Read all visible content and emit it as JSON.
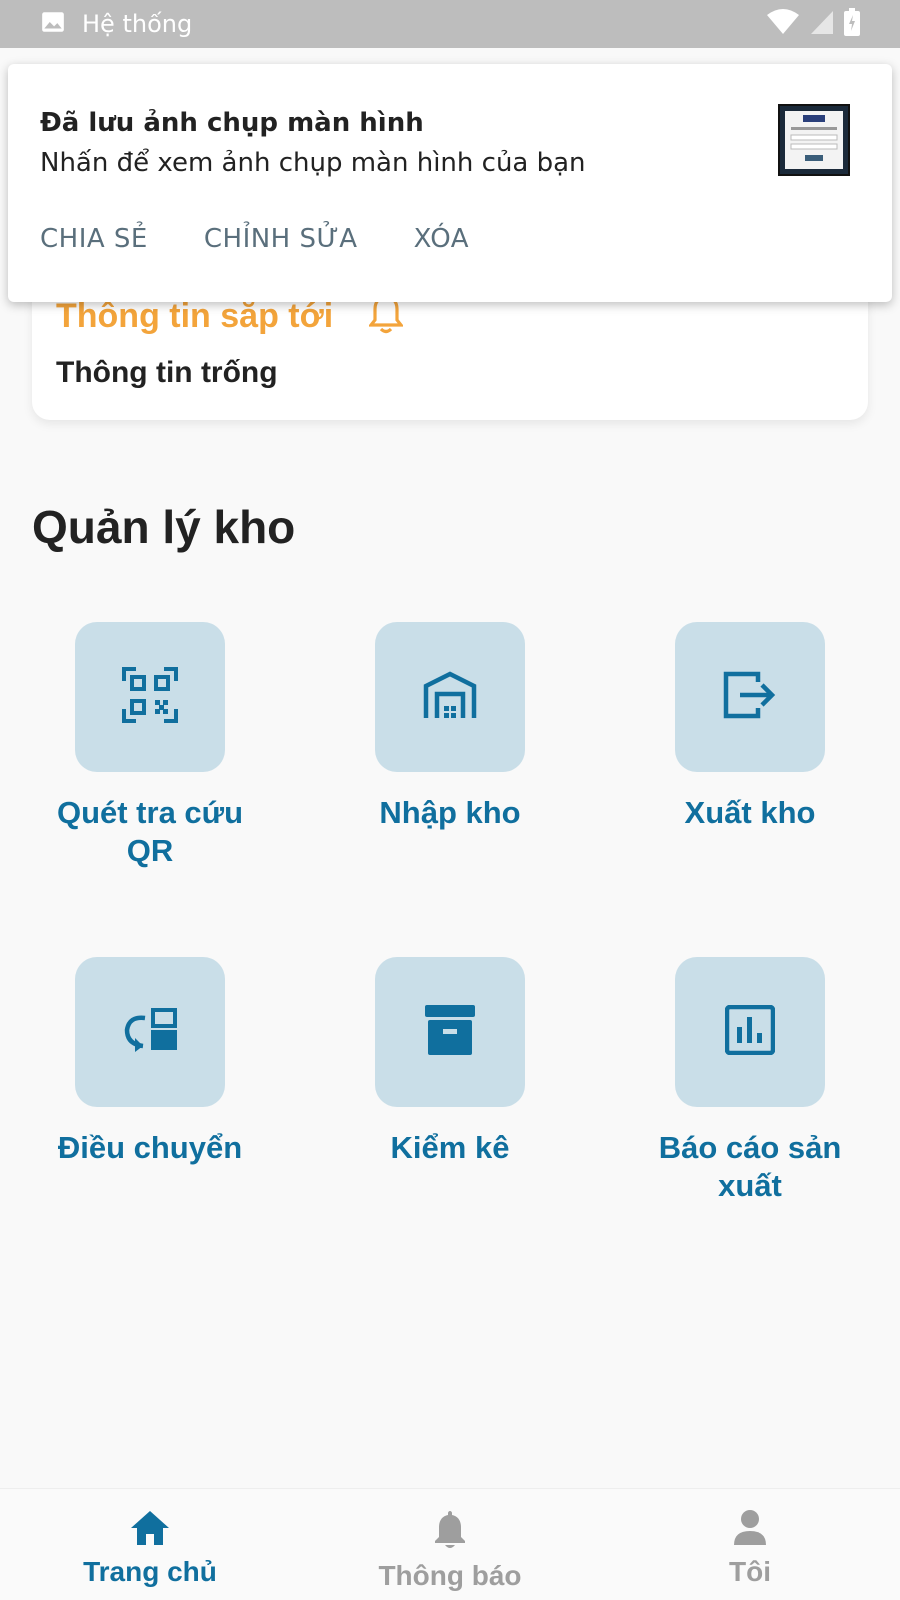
{
  "status_bar": {
    "title": "Hệ thống"
  },
  "notification": {
    "title": "Đã lưu ảnh chụp màn hình",
    "subtitle": "Nhấn để xem ảnh chụp màn hình của bạn",
    "actions": [
      "CHIA SẺ",
      "CHỈNH SỬA",
      "XÓA"
    ]
  },
  "upcoming": {
    "title": "Thông tin sắp tới",
    "empty_text": "Thông tin trống"
  },
  "section": {
    "title": "Quản lý kho"
  },
  "tiles": [
    {
      "label": "Quét tra cứu QR",
      "icon": "qr-scan-icon"
    },
    {
      "label": "Nhập kho",
      "icon": "warehouse-icon"
    },
    {
      "label": "Xuất kho",
      "icon": "export-icon"
    },
    {
      "label": "Điều chuyển",
      "icon": "transfer-icon"
    },
    {
      "label": "Kiểm kê",
      "icon": "archive-box-icon"
    },
    {
      "label": "Báo cáo sản xuất",
      "icon": "bar-chart-icon"
    }
  ],
  "bottom_nav": [
    {
      "label": "Trang chủ",
      "icon": "home-icon",
      "active": true
    },
    {
      "label": "Thông báo",
      "icon": "bell-icon",
      "active": false
    },
    {
      "label": "Tôi",
      "icon": "person-icon",
      "active": false
    }
  ],
  "colors": {
    "accent": "#106f9e",
    "tile_bg": "#c9dee8",
    "warning": "#f3a43b",
    "inactive": "#9e9e9e"
  }
}
